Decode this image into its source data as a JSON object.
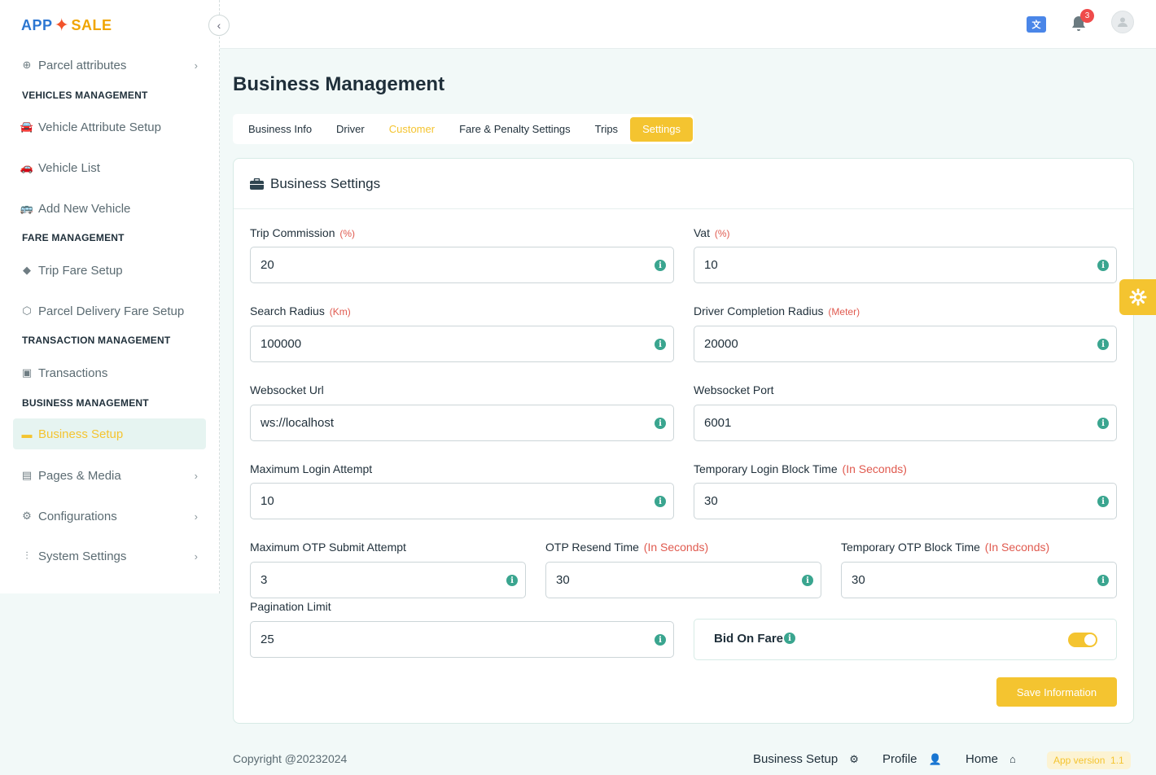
{
  "brand": {
    "logo_text_1": "APP",
    "logo_text_2": "SALE"
  },
  "sidebar": {
    "items": [
      {
        "label": "Parcel attributes",
        "icon": "plus-circle-icon",
        "has_chevron": true
      },
      {
        "heading": "VEHICLES MANAGEMENT"
      },
      {
        "label": "Vehicle Attribute Setup",
        "icon": "car-icon"
      },
      {
        "label": "Vehicle List",
        "icon": "car-side-icon"
      },
      {
        "label": "Add New Vehicle",
        "icon": "bus-icon"
      },
      {
        "heading": "FARE MANAGEMENT"
      },
      {
        "label": "Trip Fare Setup",
        "icon": "diamond-icon"
      },
      {
        "label": "Parcel Delivery Fare Setup",
        "icon": "box-icon"
      },
      {
        "heading": "TRANSACTION MANAGEMENT"
      },
      {
        "label": "Transactions",
        "icon": "wallet-icon"
      },
      {
        "heading": "BUSINESS MANAGEMENT"
      },
      {
        "label": "Business Setup",
        "icon": "briefcase-icon",
        "active": true
      },
      {
        "label": "Pages & Media",
        "icon": "file-icon",
        "has_chevron": true
      },
      {
        "label": "Configurations",
        "icon": "gear-icon",
        "has_chevron": true
      },
      {
        "label": "System Settings",
        "icon": "sliders-icon",
        "has_chevron": true
      }
    ]
  },
  "topbar": {
    "notification_count": "3"
  },
  "main": {
    "title": "Business Management",
    "tabs": [
      {
        "label": "Business Info"
      },
      {
        "label": "Driver"
      },
      {
        "label": "Customer"
      },
      {
        "label": "Fare & Penalty Settings"
      },
      {
        "label": "Trips"
      },
      {
        "label": "Settings",
        "active": true
      }
    ]
  },
  "card": {
    "title": "Business Settings",
    "fields": {
      "trip_commission": {
        "label": "Trip Commission",
        "unit": "(%)",
        "value": "20"
      },
      "vat": {
        "label": "Vat",
        "unit": "(%)",
        "value": "10"
      },
      "search_radius": {
        "label": "Search Radius",
        "unit": "(Km)",
        "value": "100000"
      },
      "driver_completion_radius": {
        "label": "Driver Completion Radius",
        "unit": "(Meter)",
        "value": "20000"
      },
      "websocket_url": {
        "label": "Websocket Url",
        "value": "ws://localhost"
      },
      "websocket_port": {
        "label": "Websocket Port",
        "value": "6001"
      },
      "max_login_attempt": {
        "label": "Maximum Login Attempt",
        "value": "10"
      },
      "temp_login_block": {
        "label": "Temporary Login Block Time",
        "unit": "(In Seconds)",
        "value": "30"
      },
      "max_otp_attempt": {
        "label": "Maximum OTP Submit Attempt",
        "value": "3"
      },
      "otp_resend_time": {
        "label": "OTP Resend Time",
        "unit": "(In Seconds)",
        "value": "30"
      },
      "temp_otp_block": {
        "label": "Temporary OTP Block Time",
        "unit": "(In Seconds)",
        "value": "30"
      },
      "pagination_limit": {
        "label": "Pagination Limit",
        "value": "25"
      }
    },
    "bid_on_fare": {
      "label": "Bid On Fare",
      "enabled": true
    },
    "save_label": "Save Information"
  },
  "footer": {
    "copyright": "Copyright @20232024",
    "links": [
      {
        "label": "Business Setup",
        "icon": "gear-icon"
      },
      {
        "label": "Profile",
        "icon": "user-icon"
      },
      {
        "label": "Home",
        "icon": "home-icon"
      }
    ],
    "version_label": "App version",
    "version": "1.1"
  },
  "colors": {
    "accent": "#f4c430",
    "info": "#3aa58f",
    "unit": "#e05a4f"
  }
}
